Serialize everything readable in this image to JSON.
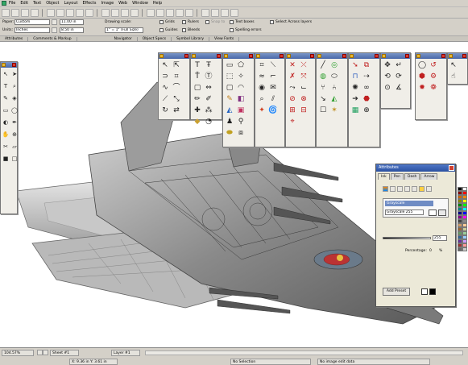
{
  "menu": [
    "File",
    "Edit",
    "Text",
    "Object",
    "Layout",
    "Effects",
    "Image",
    "Web",
    "Window",
    "Help"
  ],
  "propbar": {
    "paper_label": "Paper:",
    "paper_value": "Custom",
    "units_label": "Units:",
    "units_value": "Inches",
    "width_value": "11.00 in",
    "height_value": "8.50 in",
    "drawing_scale_label": "Drawing scale:",
    "drawing_scale_value": "1\" = 1\" (Full Size)",
    "grid_label": "Grids",
    "rulers_label": "Rulers",
    "snap_label": "Snap to",
    "guides_label": "Guides",
    "bleeds_label": "Bleeds",
    "text_boxes_label": "Text boxes",
    "spelling_label": "Spelling errors",
    "select_across_label": "Select Across layers"
  },
  "panel_tabs": [
    "Attributes",
    "Comments & Markup",
    "Navigator",
    "Object Specs",
    "Symbol Library",
    "View Fonts"
  ],
  "attributes": {
    "title": "Attributes",
    "tabs": [
      "Ink",
      "Pen",
      "Dash",
      "Arrow"
    ],
    "mode_label": "Grayscale",
    "mode_value": "Grayscale 255",
    "slider_value": "255",
    "percentage_label": "Percentage:",
    "percentage_value": "0",
    "percent_sign": "%",
    "add_preset_label": "Add Preset"
  },
  "status": {
    "zoom": "104.57%",
    "sheet": "Sheet #1",
    "layer": "Layer #1",
    "coords": "X: 9.36 in   Y: 3.61 in",
    "selection": "No Selection",
    "image_info": "No image edit data"
  },
  "colors": {
    "palette_title": "#5a78b8",
    "dialog_title": "#2a50a0",
    "chrome": "#d4d0c8"
  }
}
